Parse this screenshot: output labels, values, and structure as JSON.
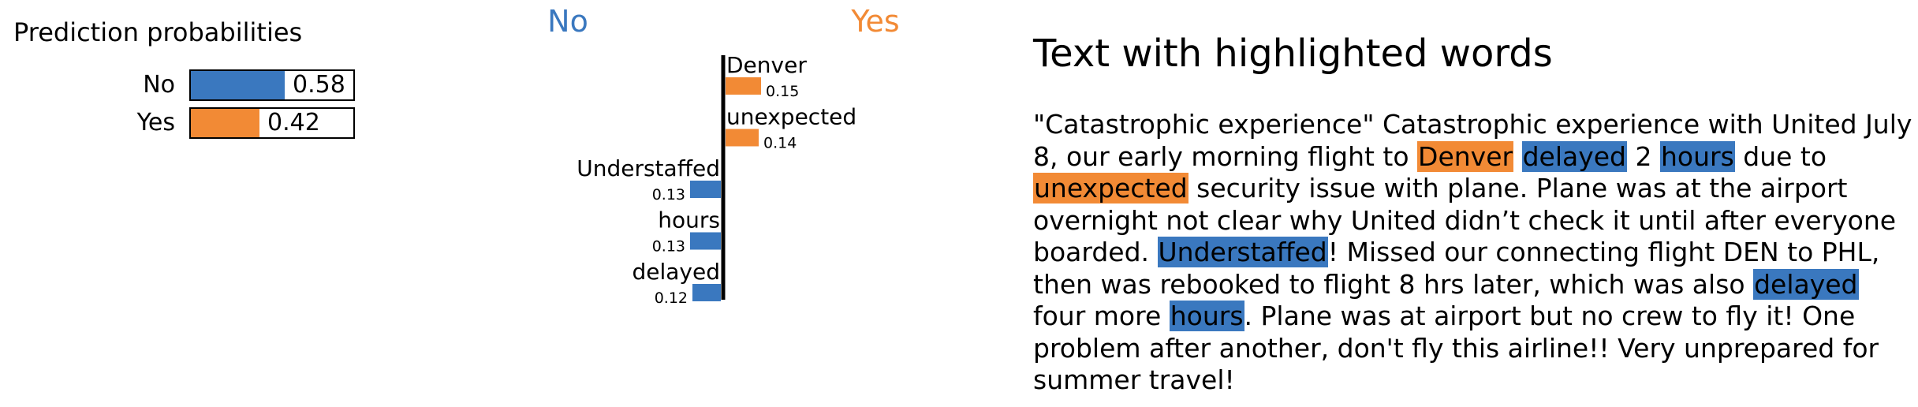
{
  "probabilities": {
    "title": "Prediction probabilities",
    "items": [
      {
        "label": "No",
        "value": 0.58,
        "value_text": "0.58",
        "color": "#3a78bf"
      },
      {
        "label": "Yes",
        "value": 0.42,
        "value_text": "0.42",
        "color": "#f28a35"
      }
    ]
  },
  "chart_data": {
    "type": "bar",
    "orientation": "horizontal-diverging",
    "class_labels": {
      "negative": "No",
      "positive": "Yes"
    },
    "colors": {
      "No": "#3a78bf",
      "Yes": "#f28a35"
    },
    "features": [
      {
        "name": "Denver",
        "weight": 0.15,
        "weight_text": "0.15",
        "class": "Yes"
      },
      {
        "name": "unexpected",
        "weight": 0.14,
        "weight_text": "0.14",
        "class": "Yes"
      },
      {
        "name": "Understaffed",
        "weight": 0.13,
        "weight_text": "0.13",
        "class": "No"
      },
      {
        "name": "hours",
        "weight": 0.13,
        "weight_text": "0.13",
        "class": "No"
      },
      {
        "name": "delayed",
        "weight": 0.12,
        "weight_text": "0.12",
        "class": "No"
      }
    ]
  },
  "text_panel": {
    "heading": "Text with highlighted words",
    "segments": [
      {
        "t": "\"Catastrophic experience\"  Catastrophic experience with United July 8, our early morning flight to "
      },
      {
        "t": "Denver",
        "hl": "Yes"
      },
      {
        "t": " "
      },
      {
        "t": "delayed",
        "hl": "No"
      },
      {
        "t": " 2 "
      },
      {
        "t": "hours",
        "hl": "No"
      },
      {
        "t": " due to "
      },
      {
        "t": "unexpected",
        "hl": "Yes"
      },
      {
        "t": " security issue with plane. Plane was at the airport overnight not clear why United didn’t check it until after everyone boarded. "
      },
      {
        "t": "Understaffed",
        "hl": "No"
      },
      {
        "t": "! Missed our connecting flight DEN to PHL, then was rebooked to flight 8 hrs later, which was also "
      },
      {
        "t": "delayed",
        "hl": "No"
      },
      {
        "t": " four more "
      },
      {
        "t": "hours",
        "hl": "No"
      },
      {
        "t": ". Plane was at airport but no crew to fly it! One problem after another, don't fly this airline!! Very unprepared for summer travel!"
      }
    ]
  }
}
